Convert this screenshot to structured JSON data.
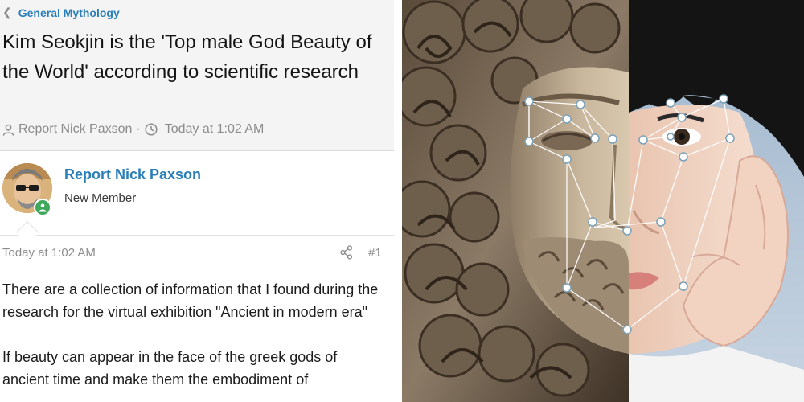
{
  "breadcrumb": {
    "label": "General Mythology"
  },
  "thread": {
    "title": "Kim Seokjin is the 'Top male God Beauty of the World' according to scientific research",
    "author": "Report Nick Paxson",
    "separator": "·",
    "date": "Today at 1:02 AM"
  },
  "post": {
    "username": "Report Nick Paxson",
    "user_title": "New Member",
    "date": "Today at 1:02 AM",
    "number": "#1",
    "paragraphs": [
      "There are a collection of information that I found during the research for the virtual exhibition \"Ancient in modern era\"",
      "If beauty can appear in the face of the greek gods of ancient time and make them the embodiment of"
    ]
  },
  "icons": {
    "back": "chevron-left-icon",
    "user": "user-icon",
    "clock": "clock-icon",
    "share": "share-icon",
    "online": "online-status-icon"
  },
  "colors": {
    "link": "#2b7fb8",
    "meta": "#8c8c8c",
    "online": "#3fa85a"
  }
}
